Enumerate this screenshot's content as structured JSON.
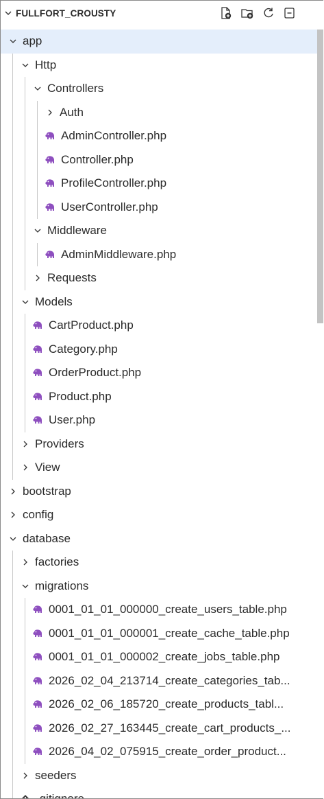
{
  "explorer": {
    "title": "FULLFORT_CROUSTY",
    "actions": [
      "new-file-icon",
      "new-folder-icon",
      "refresh-icon",
      "collapse-all-icon"
    ]
  },
  "colors": {
    "php_icon": "#8e4fbf",
    "selected_row": "#e4eefb",
    "guide": "#c8c8c8"
  },
  "tree": [
    {
      "label": "app",
      "depth": 0,
      "type": "folder",
      "expanded": true,
      "selected": true
    },
    {
      "label": "Http",
      "depth": 1,
      "type": "folder",
      "expanded": true
    },
    {
      "label": "Controllers",
      "depth": 2,
      "type": "folder",
      "expanded": true
    },
    {
      "label": "Auth",
      "depth": 3,
      "type": "folder",
      "expanded": false
    },
    {
      "label": "AdminController.php",
      "depth": 3,
      "type": "php"
    },
    {
      "label": "Controller.php",
      "depth": 3,
      "type": "php"
    },
    {
      "label": "ProfileController.php",
      "depth": 3,
      "type": "php"
    },
    {
      "label": "UserController.php",
      "depth": 3,
      "type": "php"
    },
    {
      "label": "Middleware",
      "depth": 2,
      "type": "folder",
      "expanded": true
    },
    {
      "label": "AdminMiddleware.php",
      "depth": 3,
      "type": "php"
    },
    {
      "label": "Requests",
      "depth": 2,
      "type": "folder",
      "expanded": false
    },
    {
      "label": "Models",
      "depth": 1,
      "type": "folder",
      "expanded": true
    },
    {
      "label": "CartProduct.php",
      "depth": 2,
      "type": "php"
    },
    {
      "label": "Category.php",
      "depth": 2,
      "type": "php"
    },
    {
      "label": "OrderProduct.php",
      "depth": 2,
      "type": "php"
    },
    {
      "label": "Product.php",
      "depth": 2,
      "type": "php"
    },
    {
      "label": "User.php",
      "depth": 2,
      "type": "php"
    },
    {
      "label": "Providers",
      "depth": 1,
      "type": "folder",
      "expanded": false
    },
    {
      "label": "View",
      "depth": 1,
      "type": "folder",
      "expanded": false
    },
    {
      "label": "bootstrap",
      "depth": 0,
      "type": "folder",
      "expanded": false
    },
    {
      "label": "config",
      "depth": 0,
      "type": "folder",
      "expanded": false
    },
    {
      "label": "database",
      "depth": 0,
      "type": "folder",
      "expanded": true
    },
    {
      "label": "factories",
      "depth": 1,
      "type": "folder",
      "expanded": false
    },
    {
      "label": "migrations",
      "depth": 1,
      "type": "folder",
      "expanded": true
    },
    {
      "label": "0001_01_01_000000_create_users_table.php",
      "depth": 2,
      "type": "php"
    },
    {
      "label": "0001_01_01_000001_create_cache_table.php",
      "depth": 2,
      "type": "php"
    },
    {
      "label": "0001_01_01_000002_create_jobs_table.php",
      "depth": 2,
      "type": "php"
    },
    {
      "label": "2026_02_04_213714_create_categories_tab...",
      "depth": 2,
      "type": "php"
    },
    {
      "label": "2026_02_06_185720_create_products_tabl...",
      "depth": 2,
      "type": "php"
    },
    {
      "label": "2026_02_27_163445_create_cart_products_...",
      "depth": 2,
      "type": "php"
    },
    {
      "label": "2026_04_02_075915_create_order_product...",
      "depth": 2,
      "type": "php"
    },
    {
      "label": "seeders",
      "depth": 1,
      "type": "folder",
      "expanded": false
    },
    {
      "label": ".gitignore",
      "depth": 1,
      "type": "git"
    }
  ]
}
